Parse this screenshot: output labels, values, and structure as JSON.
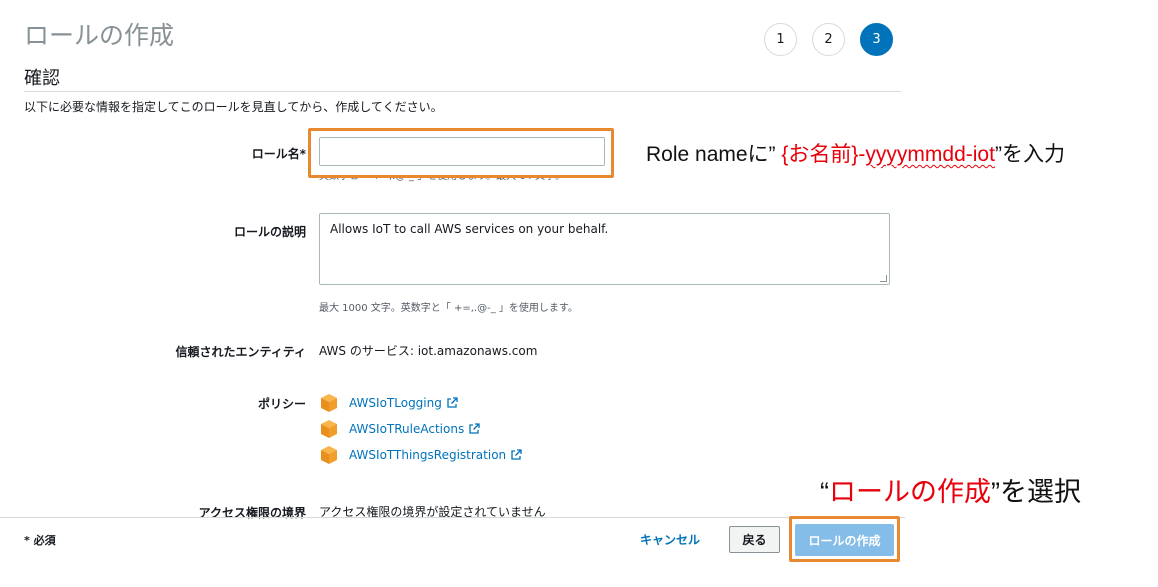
{
  "header": {
    "title": "ロールの作成",
    "steps": [
      "1",
      "2",
      "3"
    ]
  },
  "section": {
    "title": "確認",
    "intro": "以下に必要な情報を指定してこのロールを見直してから、作成してください。"
  },
  "role_name": {
    "label": "ロール名*",
    "value": "",
    "hint": "英数字と「 +=,.@-_ 」を使用します。最大 64 文字。"
  },
  "role_description": {
    "label": "ロールの説明",
    "value": "Allows IoT to call AWS services on your behalf.",
    "hint": "最大 1000 文字。英数字と「 +=,.@-_ 」を使用します。"
  },
  "trusted_entity": {
    "label": "信頼されたエンティティ",
    "value": "AWS のサービス: iot.amazonaws.com"
  },
  "policies": {
    "label": "ポリシー",
    "items": [
      "AWSIoTLogging",
      "AWSIoTRuleActions",
      "AWSIoTThingsRegistration"
    ]
  },
  "permissions_boundary": {
    "label": "アクセス権限の境界",
    "value": "アクセス権限の境界が設定されていません"
  },
  "footer": {
    "required": "* 必須",
    "cancel": "キャンセル",
    "back": "戻る",
    "create": "ロールの作成"
  },
  "annotations": {
    "callout1_pre": "Role nameに” ",
    "callout1_red": "{お名前}-",
    "callout1_red_squiggle": "yyyymmdd-iot",
    "callout1_post": "”を入力",
    "callout2_pre": "“",
    "callout2_red": "ロールの作成",
    "callout2_post": "”を選択"
  },
  "colors": {
    "accent": "#0073bb",
    "highlight_box": "#e8892f",
    "annotation_red": "#e8000b",
    "primary_button_disabled": "#83bde8"
  },
  "icons": {
    "policy": "aws-policy-cube-icon",
    "external_link": "external-link-icon"
  }
}
